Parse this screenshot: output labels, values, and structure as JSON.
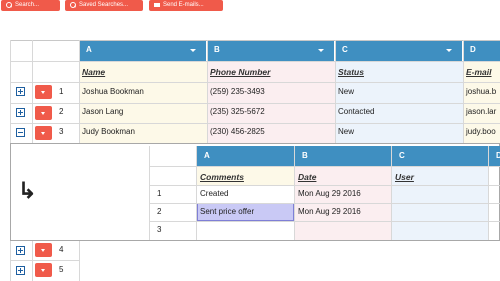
{
  "toolbar": {
    "search_label": "Search...",
    "saved_searches_label": "Saved Searches...",
    "send_emails_label": "Send E-mails..."
  },
  "main_grid": {
    "columns": [
      {
        "letter": "A",
        "field": "Name"
      },
      {
        "letter": "B",
        "field": "Phone Number"
      },
      {
        "letter": "C",
        "field": "Status"
      },
      {
        "letter": "D",
        "field": "E-mail"
      }
    ],
    "rows": [
      {
        "num": "1",
        "expanded": false,
        "name": "Joshua Bookman",
        "phone": "(259) 235-3493",
        "status": "New",
        "email": "joshua.b"
      },
      {
        "num": "2",
        "expanded": false,
        "name": "Jason Lang",
        "phone": "(235) 325-5672",
        "status": "Contacted",
        "email": "jason.lar"
      },
      {
        "num": "3",
        "expanded": true,
        "name": "Judy Bookman",
        "phone": "(230) 456-2825",
        "status": "New",
        "email": "judy.boo"
      },
      {
        "num": "4",
        "expanded": false
      },
      {
        "num": "5",
        "expanded": false
      }
    ]
  },
  "sub_grid": {
    "return_arrow": "↳",
    "columns": [
      {
        "letter": "A",
        "field": "Comments"
      },
      {
        "letter": "B",
        "field": "Date"
      },
      {
        "letter": "C",
        "field": "User"
      },
      {
        "letter": "D",
        "field": ""
      }
    ],
    "rows": [
      {
        "num": "1",
        "comment": "Created",
        "date": "Mon Aug 29 2016",
        "user": ""
      },
      {
        "num": "2",
        "comment": "Sent price offer",
        "date": "Mon Aug 29 2016",
        "user": ""
      },
      {
        "num": "3",
        "comment": "",
        "date": "",
        "user": ""
      }
    ]
  },
  "colors": {
    "header_blue": "#3f8fc1",
    "button_red": "#f05a4a",
    "row_yellow": "#fdf9e8",
    "column_pink": "#fbeef0",
    "column_blue": "#ecf3fb",
    "selection": "#c9c9f5"
  }
}
